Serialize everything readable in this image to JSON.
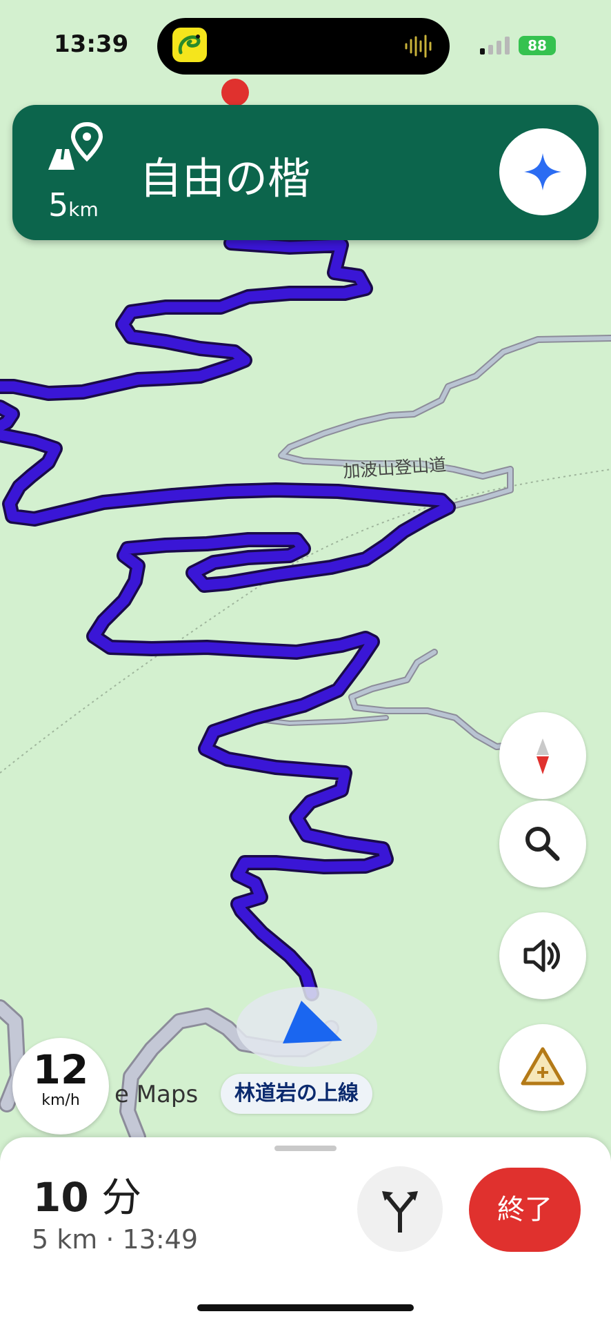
{
  "status_bar": {
    "time": "13:39",
    "battery": "88"
  },
  "guidance": {
    "distance_value": "5",
    "distance_unit": "km",
    "street": "自由の楷",
    "icon": "route-destination-icon"
  },
  "map": {
    "trail_label": "加波山登山道",
    "current_road": "林道岩の上線",
    "watermark": "e Maps",
    "route_color": "#3a16d6"
  },
  "speed": {
    "value": "12",
    "unit": "km/h"
  },
  "trip": {
    "duration_value": "10",
    "duration_unit": "分",
    "summary": "5 km · 13:49",
    "end_label": "終了"
  },
  "colors": {
    "banner": "#0c654c",
    "end_button": "#e0312e",
    "map_bg": "#d3f0cf",
    "position_arrow": "#1a66f0"
  },
  "controls": [
    "compass-icon",
    "search-icon",
    "volume-icon",
    "report-hazard-icon"
  ]
}
